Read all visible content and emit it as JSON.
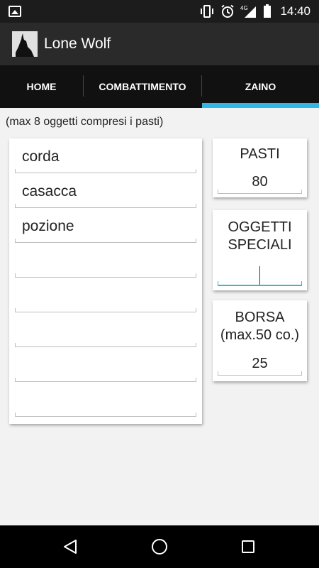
{
  "status_bar": {
    "time": "14:40",
    "network": "4G"
  },
  "action_bar": {
    "title": "Lone Wolf"
  },
  "tabs": [
    {
      "label": "HOME",
      "selected": false
    },
    {
      "label": "COMBATTIMENTO",
      "selected": false
    },
    {
      "label": "ZAINO",
      "selected": true
    }
  ],
  "backpack": {
    "hint": "(max 8 oggetti compresi i pasti)",
    "items": [
      "corda",
      "casacca",
      "pozione",
      "",
      "",
      "",
      "",
      ""
    ]
  },
  "meals": {
    "label": "PASTI",
    "value": "80"
  },
  "special_items": {
    "label_line1": "OGGETTI",
    "label_line2": "SPECIALI",
    "value": ""
  },
  "purse": {
    "label_line1": "BORSA",
    "label_line2": "(max.50 co.)",
    "value": "25"
  },
  "colors": {
    "accent": "#33b5e5",
    "action_bar": "#2a2a2a",
    "tab_bar": "#111111",
    "content_bg": "#f2f2f2"
  }
}
